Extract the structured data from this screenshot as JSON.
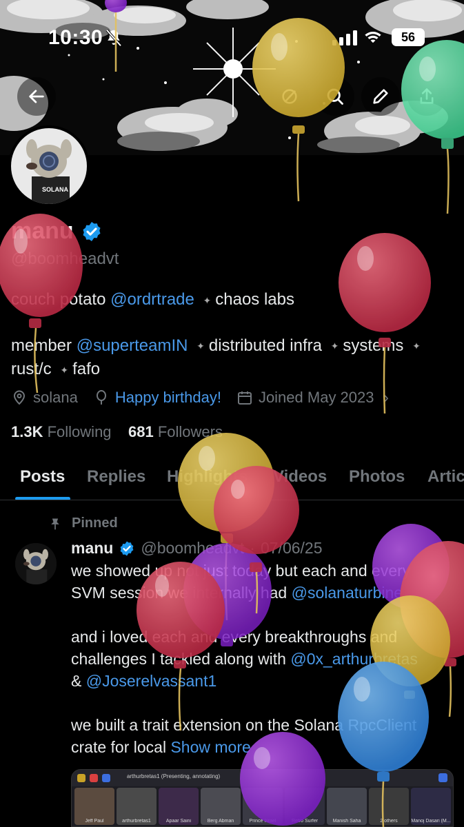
{
  "status_bar": {
    "time": "10:30",
    "battery": "56"
  },
  "profile": {
    "name": "manu",
    "handle": "@boomheadvt",
    "bio": {
      "line1_pre": "couch potato",
      "line1_mention": "@ordrtrade",
      "line1_post": "chaos labs",
      "line2_pre": "member",
      "line2_mention": "@superteamIN",
      "line2_mid": "distributed infra",
      "line2_post": "systems",
      "line3_a": "rust/c",
      "line3_b": "fafo"
    },
    "location": "solana",
    "birthday": "Happy birthday!",
    "joined": "Joined May 2023",
    "following_count": "1.3K",
    "following_label": "Following",
    "followers_count": "681",
    "followers_label": "Followers"
  },
  "tabs": [
    "Posts",
    "Replies",
    "Highlights",
    "Videos",
    "Photos",
    "Articles"
  ],
  "post": {
    "pinned_label": "Pinned",
    "author": "manu",
    "handle": "@boomheadvt",
    "date": "07/06/25",
    "para1_line1": "we showed up not just today but each and every",
    "para1_line2_pre": "SVM session we internally had",
    "para1_line2_mention": "@solanaturbine",
    "para2_line1": "and i loved each and every breakthroughs and",
    "para2_line2_pre": "challenges I tackled along with",
    "para2_line2_mention": "@0x_arthurbretas",
    "para2_line3_pre": "&",
    "para2_line3_mention": "@Joserelvassant1",
    "para3_line1": "we built a trait extension on the Solana RpcClient",
    "para3_line2_pre": "crate for local",
    "show_more": "Show more",
    "media": {
      "title": "arthurbretas1 (Presenting, annotating)",
      "participants": [
        "Jeff Paul",
        "arthurbretas1",
        "Apaar Saini",
        "Berg Abman",
        "Prince Israel",
        "Retro Surfer",
        "Manish Saha",
        "2 others",
        "Manoj Dasari (M..."
      ]
    }
  },
  "colors": {
    "accent": "#1d9bf0",
    "link": "#4a99e9",
    "muted": "#71767b",
    "text": "#e7e9ea",
    "background": "#000000"
  },
  "icons": [
    "back-arrow-icon",
    "grok-icon",
    "search-icon",
    "edit-icon",
    "share-icon",
    "verified-badge-icon",
    "location-icon",
    "balloon-icon",
    "calendar-icon",
    "pin-icon",
    "bell-slash-icon",
    "signal-icon",
    "wifi-icon"
  ]
}
